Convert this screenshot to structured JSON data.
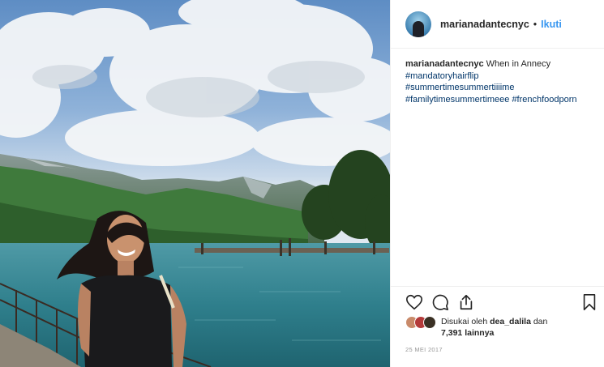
{
  "header": {
    "username": "marianadantecnyc",
    "separator": "•",
    "follow_label": "Ikuti"
  },
  "caption": {
    "username": "marianadantecnyc",
    "text": "When in Annecy",
    "hashtags": [
      "#mandatoryhairflip",
      "#summertimesummertiiiime",
      "#familytimesummertimeee",
      "#frenchfoodporn"
    ]
  },
  "actions": {
    "like_icon": "heart-icon",
    "comment_icon": "comment-icon",
    "share_icon": "share-icon",
    "save_icon": "bookmark-icon"
  },
  "likes": {
    "prefix": "Disukai oleh",
    "liker": "dea_dalila",
    "conjunction": "dan",
    "count": "7,391 lainnya"
  },
  "date": "25 MEI 2017",
  "colors": {
    "link": "#3897f0",
    "hashtag": "#003569",
    "border": "#efefef"
  }
}
